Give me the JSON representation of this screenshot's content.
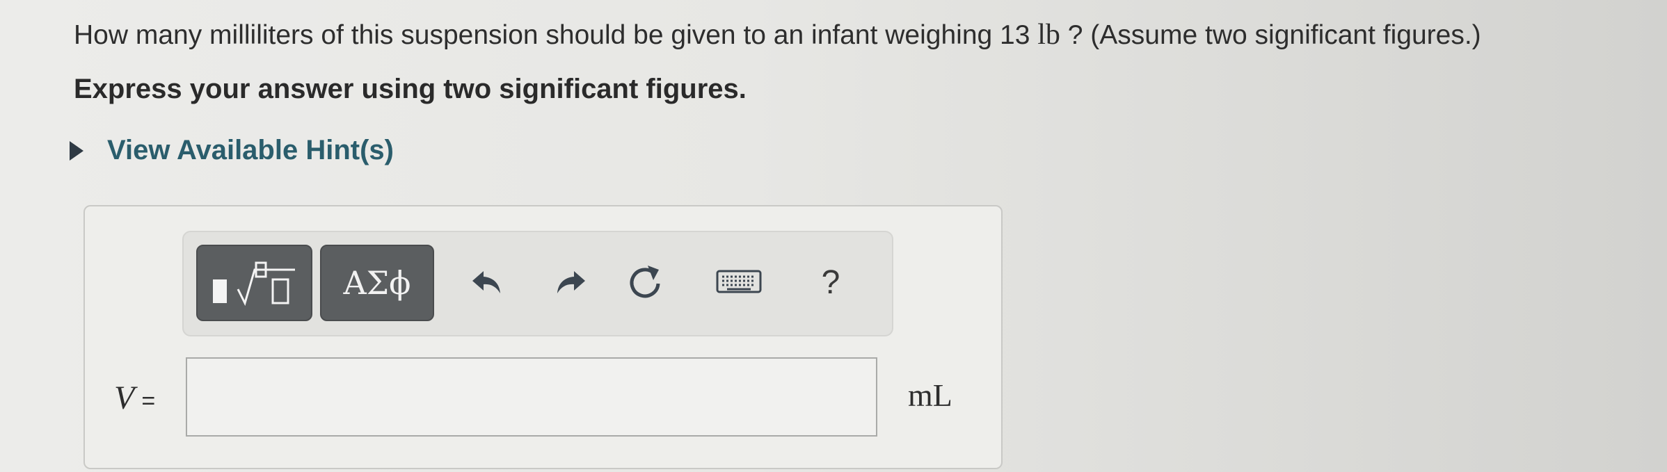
{
  "question": {
    "text_before": "How many milliliters of this suspension should be given to an infant weighing 13 ",
    "unit": "lb",
    "text_after": " ? (Assume two significant figures.)"
  },
  "instruction": "Express your answer using two significant figures.",
  "hints": {
    "label": "View Available Hint(s)"
  },
  "toolbar": {
    "greek_label": "ΑΣϕ",
    "help_label": "?",
    "icons": [
      "templates-icon",
      "undo-icon",
      "redo-icon",
      "reset-icon",
      "keyboard-icon",
      "help-icon"
    ]
  },
  "answer": {
    "variable": "V",
    "equals": "=",
    "value": "",
    "unit": "mL"
  }
}
